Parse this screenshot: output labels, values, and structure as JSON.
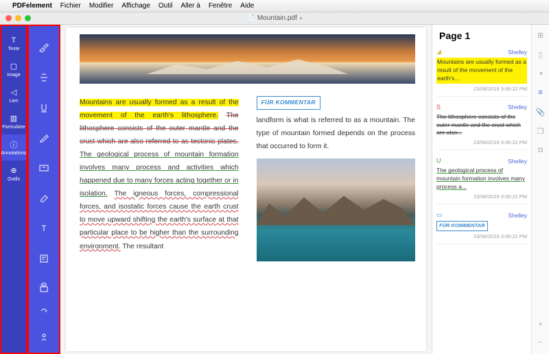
{
  "menubar": {
    "app": "PDFelement",
    "items": [
      "Fichier",
      "Modifier",
      "Affichage",
      "Outil",
      "Aller à",
      "Fenêtre",
      "Aide"
    ]
  },
  "document": {
    "title": "Mountain.pdf"
  },
  "sidebar": {
    "items": [
      {
        "label": "Texte",
        "icon": "T"
      },
      {
        "label": "Image",
        "icon": "▢"
      },
      {
        "label": "Lien",
        "icon": "◁"
      },
      {
        "label": "Formulaire",
        "icon": "▥"
      },
      {
        "label": "Annotations",
        "icon": "ⓘ"
      },
      {
        "label": "Outils",
        "icon": "⊕"
      }
    ],
    "active_index": 4
  },
  "tools": [
    "highlight",
    "strikethrough",
    "underline",
    "pencil",
    "textbox",
    "eraser",
    "typewriter",
    "note"
  ],
  "bottom_tools": [
    "undo",
    "redo",
    "signature"
  ],
  "page": {
    "col1": {
      "hl": "Mountains are usually formed as a result of the movement of the earth's lithosphere.",
      "strike": "The lithosphere consists of the outer mantle and the crust which are also referred to as tectonic plates.",
      "under_g": "The geological process of mountain formation involves many process and activities which happened due to many forces acting together or in isolation.",
      "squig": "The igneous forces, compressional forces, and isostatic forces cause the earth crust to move upward shifting the earth's surface at that particular place to be higher than the surrounding environment.",
      "tail": "The resultant"
    },
    "col2": {
      "comment_label": "FÜR KOMMENTAR",
      "text": "landform is what is referred to as a mountain. The type of mountain formed depends on the process that occurred to form it."
    }
  },
  "comments_panel": {
    "heading": "Page 1",
    "notes": [
      {
        "icon": "◢",
        "author": "Shelley",
        "text": "Mountains are usually formed as a result of the movement of the earth's...",
        "style": "hl",
        "time": "23/06/2019 3:06:22 PM"
      },
      {
        "icon": "S",
        "author": "Shelley",
        "text": "The lithosphere consists of the outer mantle and the crust which are also...",
        "style": "strike",
        "time": "23/06/2019 3:06:22 PM"
      },
      {
        "icon": "U",
        "author": "Shelley",
        "text": "The geological process of mountain formation involves many process a...",
        "style": "under-g",
        "time": "23/06/2019 3:06:22 PM"
      },
      {
        "icon": "▭",
        "author": "Shelley",
        "text": "FÜR KOMMENTAR",
        "style": "comment",
        "time": "23/06/2019 3:06:22 PM"
      }
    ]
  },
  "rail": {
    "icons": [
      "grid",
      "page",
      "bookmark",
      "list",
      "attach",
      "copy",
      "copy2"
    ],
    "active_index": 3,
    "bottom": [
      "plus",
      "minus"
    ]
  }
}
